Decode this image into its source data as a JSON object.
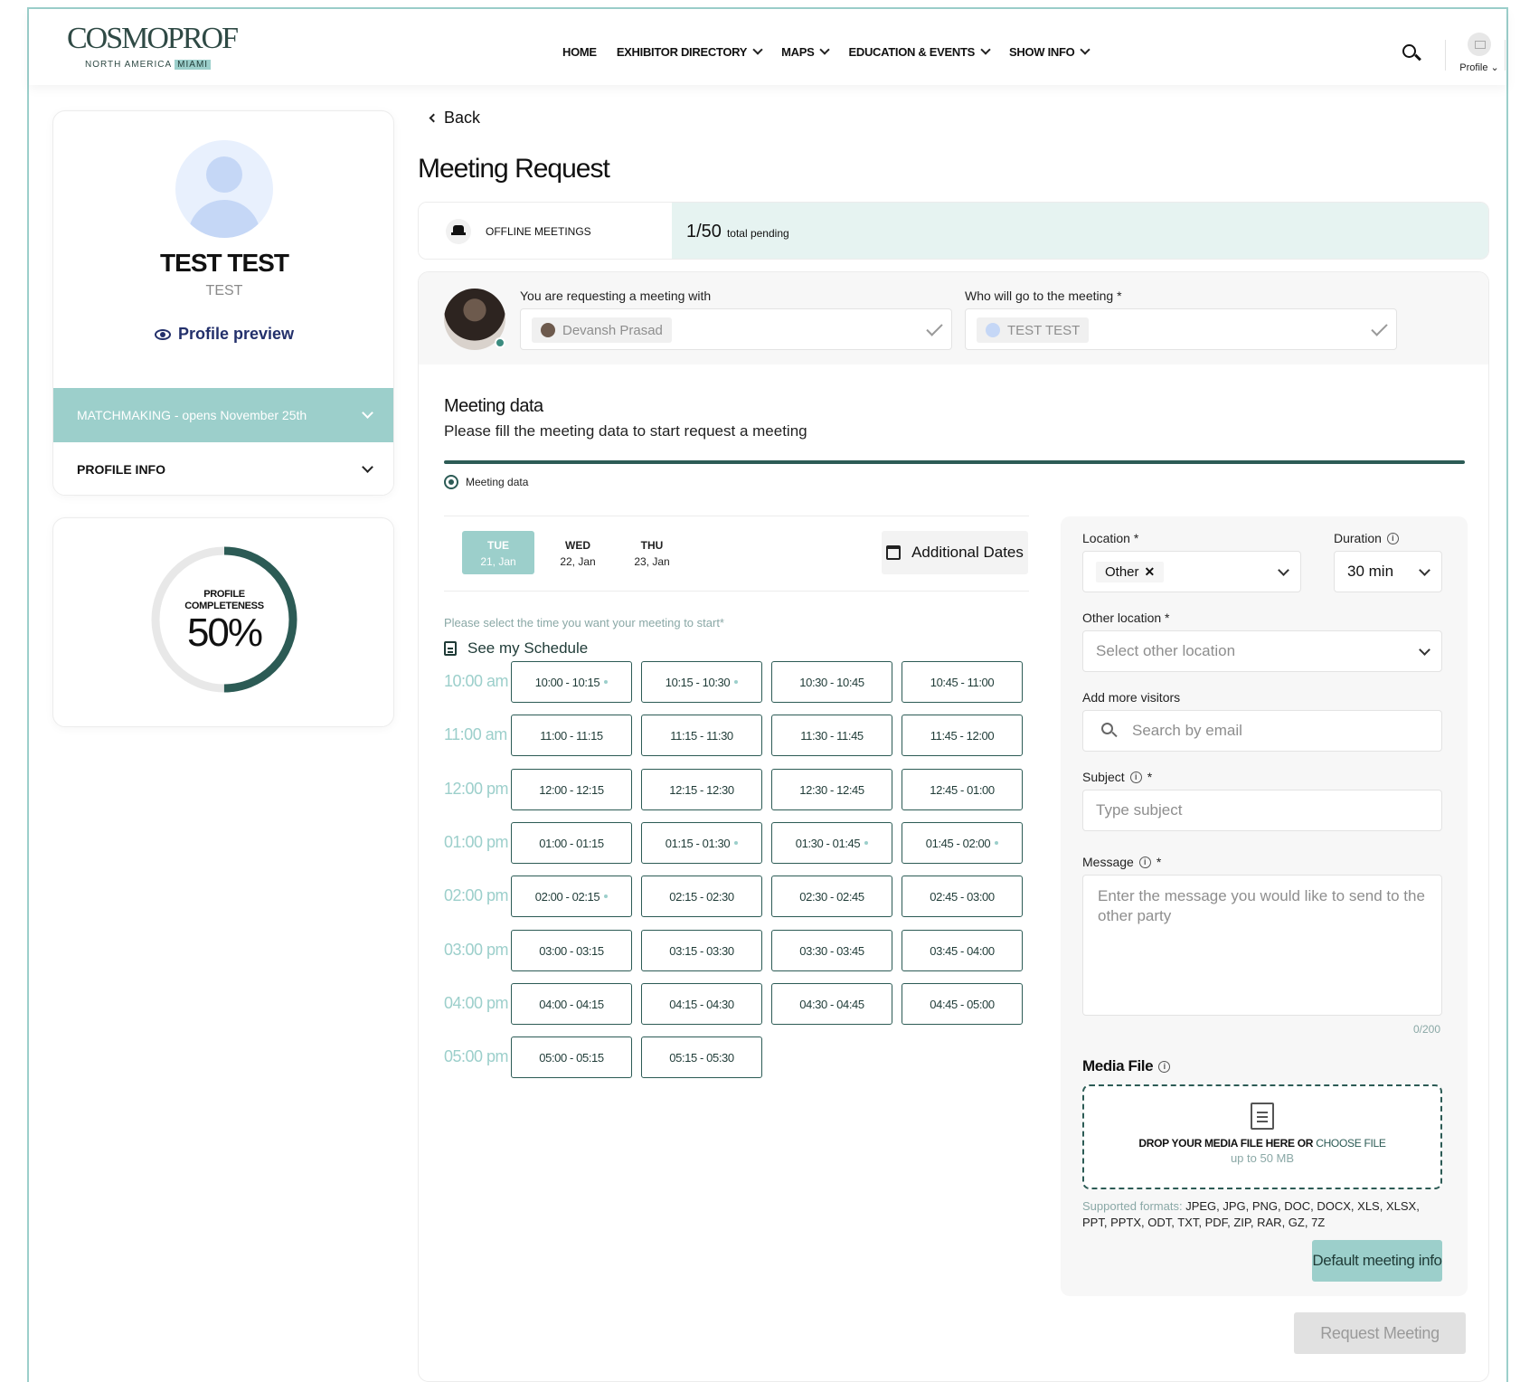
{
  "header": {
    "logo_main": "COSMOPROF",
    "logo_sub": "NORTH AMERICA",
    "logo_tag": "MIAMI",
    "nav": [
      {
        "label": "HOME",
        "dropdown": false
      },
      {
        "label": "EXHIBITOR DIRECTORY",
        "dropdown": true
      },
      {
        "label": "MAPS",
        "dropdown": true
      },
      {
        "label": "EDUCATION & EVENTS",
        "dropdown": true
      },
      {
        "label": "SHOW INFO",
        "dropdown": true
      }
    ],
    "profile_label": "Profile ⌄"
  },
  "sidebar": {
    "user_name": "TEST TEST",
    "user_sub": "TEST",
    "preview_label": "Profile preview",
    "accordion_matchmaking": "MATCHMAKING - opens November 25th",
    "accordion_profile_info": "PROFILE INFO",
    "completeness_label_1": "PROFILE",
    "completeness_label_2": "COMPLETENESS",
    "completeness_value": "50%",
    "completeness_fraction": 0.5
  },
  "main": {
    "back_label": "Back",
    "title": "Meeting Request",
    "offline_label": "OFFLINE MEETINGS",
    "pending_count": "1/50",
    "pending_label": "total pending",
    "requesting_label": "You are requesting a meeting with",
    "requesting_value": "Devansh Prasad",
    "who_label": "Who will go to the meeting *",
    "who_value": "TEST TEST",
    "section_title": "Meeting data",
    "section_sub": "Please fill the meeting data to start request a meeting",
    "step_label": "Meeting data",
    "dates": [
      {
        "dow": "TUE",
        "date": "21, Jan",
        "active": true
      },
      {
        "dow": "WED",
        "date": "22, Jan",
        "active": false
      },
      {
        "dow": "THU",
        "date": "23, Jan",
        "active": false
      }
    ],
    "additional_dates": "Additional Dates",
    "select_hint": "Please select the time you want your meeting to start*",
    "schedule_link": "See my Schedule",
    "hours": [
      {
        "label": "10:00 am",
        "slots": [
          {
            "t": "10:00 - 10:15",
            "dot": true
          },
          {
            "t": "10:15 - 10:30",
            "dot": true
          },
          {
            "t": "10:30 - 10:45",
            "dot": false
          },
          {
            "t": "10:45 - 11:00",
            "dot": false
          }
        ]
      },
      {
        "label": "11:00 am",
        "slots": [
          {
            "t": "11:00 - 11:15",
            "dot": false
          },
          {
            "t": "11:15 - 11:30",
            "dot": false
          },
          {
            "t": "11:30 - 11:45",
            "dot": false
          },
          {
            "t": "11:45 - 12:00",
            "dot": false
          }
        ]
      },
      {
        "label": "12:00 pm",
        "slots": [
          {
            "t": "12:00 - 12:15",
            "dot": false
          },
          {
            "t": "12:15 - 12:30",
            "dot": false
          },
          {
            "t": "12:30 - 12:45",
            "dot": false
          },
          {
            "t": "12:45 - 01:00",
            "dot": false
          }
        ]
      },
      {
        "label": "01:00 pm",
        "slots": [
          {
            "t": "01:00 - 01:15",
            "dot": false
          },
          {
            "t": "01:15 - 01:30",
            "dot": true
          },
          {
            "t": "01:30 - 01:45",
            "dot": true
          },
          {
            "t": "01:45 - 02:00",
            "dot": true
          }
        ]
      },
      {
        "label": "02:00 pm",
        "slots": [
          {
            "t": "02:00 - 02:15",
            "dot": true
          },
          {
            "t": "02:15 - 02:30",
            "dot": false
          },
          {
            "t": "02:30 - 02:45",
            "dot": false
          },
          {
            "t": "02:45 - 03:00",
            "dot": false
          }
        ]
      },
      {
        "label": "03:00 pm",
        "slots": [
          {
            "t": "03:00 - 03:15",
            "dot": false
          },
          {
            "t": "03:15 - 03:30",
            "dot": false
          },
          {
            "t": "03:30 - 03:45",
            "dot": false
          },
          {
            "t": "03:45 - 04:00",
            "dot": false
          }
        ]
      },
      {
        "label": "04:00 pm",
        "slots": [
          {
            "t": "04:00 - 04:15",
            "dot": false
          },
          {
            "t": "04:15 - 04:30",
            "dot": false
          },
          {
            "t": "04:30 - 04:45",
            "dot": false
          },
          {
            "t": "04:45 - 05:00",
            "dot": false
          }
        ]
      },
      {
        "label": "05:00 pm",
        "slots": [
          {
            "t": "05:00 - 05:15",
            "dot": false
          },
          {
            "t": "05:15 - 05:30",
            "dot": false
          }
        ]
      }
    ]
  },
  "form": {
    "location_label": "Location *",
    "location_value": "Other",
    "duration_label": "Duration",
    "duration_value": "30 min",
    "other_location_label": "Other location *",
    "other_location_placeholder": "Select other location",
    "visitors_label": "Add more visitors",
    "visitors_placeholder": "Search by email",
    "subject_label": "Subject",
    "subject_required": "*",
    "subject_placeholder": "Type subject",
    "message_label": "Message",
    "message_required": "*",
    "message_placeholder": "Enter the message you would like to send to the other party",
    "message_counter": "0/200",
    "media_title": "Media File",
    "drop_text": "DROP YOUR MEDIA FILE HERE OR",
    "drop_link": "CHOOSE FILE",
    "drop_sub": "up to 50 MB",
    "formats_label": "Supported formats:",
    "formats_value": "JPEG, JPG, PNG, DOC, DOCX, XLS, XLSX, PPT, PPTX, ODT, TXT, PDF, ZIP, RAR, GZ, 7Z",
    "default_button": "Default meeting info",
    "request_button": "Request Meeting"
  },
  "colors": {
    "accent": "#9ccfcb",
    "dark_teal": "#2c5b55",
    "pending_bg": "#e6f3f1",
    "link_navy": "#23306b"
  }
}
